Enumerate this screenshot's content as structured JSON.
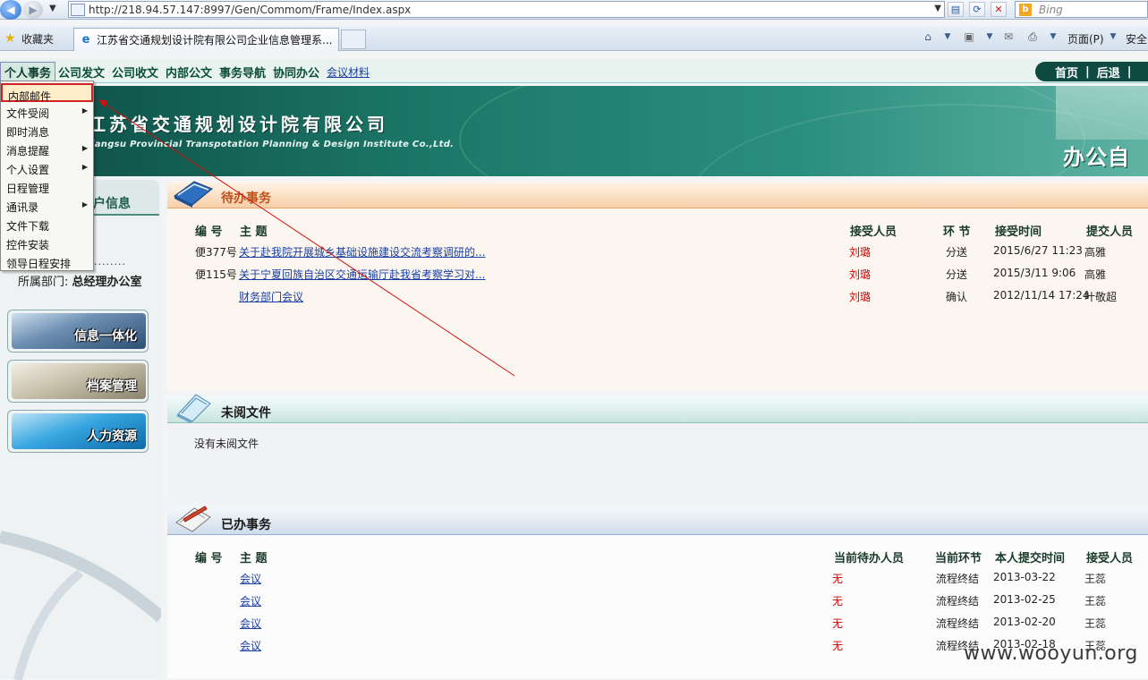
{
  "browser": {
    "url": "http://218.94.57.147:8997/Gen/Commom/Frame/Index.aspx",
    "search_placeholder": "Bing",
    "favorites_label": "收藏夹",
    "tab_title": "江苏省交通规划设计院有限公司企业信息管理系...",
    "page_menu": "页面(P)",
    "safety_menu": "安全"
  },
  "app_menu": {
    "items": [
      "个人事务",
      "公司发文",
      "公司收文",
      "内部公文",
      "事务导航",
      "协同办公"
    ],
    "link": "会议材料",
    "topnav": [
      "首页",
      "后退"
    ]
  },
  "banner": {
    "company_cn": "江苏省交通规划设计院有限公司",
    "company_en": "Jiangsu Provincial Transpotation Planning & Design Institute Co.,Ltd.",
    "system": "办公自动"
  },
  "dropdown": {
    "items": [
      {
        "label": "内部邮件",
        "arrow": ""
      },
      {
        "label": "文件受阅",
        "arrow": "▶"
      },
      {
        "label": "即时消息",
        "arrow": ""
      },
      {
        "label": "消息提醒",
        "arrow": "▶"
      },
      {
        "label": "个人设置",
        "arrow": "▶"
      },
      {
        "label": "日程管理",
        "arrow": ""
      },
      {
        "label": "通讯录",
        "arrow": "▶"
      },
      {
        "label": "文件下载",
        "arrow": ""
      },
      {
        "label": "控件安装",
        "arrow": ""
      },
      {
        "label": "领导日程安排",
        "arrow": ""
      }
    ]
  },
  "sidebar": {
    "userinfo_title": "户信息",
    "dots": "........",
    "dept_label": "所属部门:",
    "dept_value": "总经理办公室",
    "buttons": [
      "信息一体化",
      "档案管理",
      "人力资源"
    ]
  },
  "todo": {
    "title": "待办事务",
    "headers": {
      "id": "编 号",
      "subject": "主 题",
      "receiver": "接受人员",
      "step": "环 节",
      "time": "接受时间",
      "submitter": "提交人员"
    },
    "rows": [
      {
        "id": "便377号",
        "subject": "关于赴我院开展城乡基础设施建设交流考察调研的...",
        "receiver": "刘璐",
        "step": "分送",
        "time": "2015/6/27 11:23",
        "submitter": "高雅"
      },
      {
        "id": "便115号",
        "subject": "关于宁夏回族自治区交通运输厅赴我省考察学习对...",
        "receiver": "刘璐",
        "step": "分送",
        "time": "2015/3/11 9:06",
        "submitter": "高雅"
      },
      {
        "id": "",
        "subject": "财务部门会议",
        "receiver": "刘璐",
        "step": "确认",
        "time": "2012/11/14 17:24",
        "submitter": "叶敬超"
      }
    ]
  },
  "unread": {
    "title": "未阅文件",
    "empty_text": "没有未阅文件"
  },
  "done": {
    "title": "已办事务",
    "headers": {
      "id": "编 号",
      "subject": "主 题",
      "pending": "当前待办人员",
      "step": "当前环节",
      "time": "本人提交时间",
      "receiver": "接受人员"
    },
    "rows": [
      {
        "subject": "会议",
        "pending": "无",
        "step": "流程终结",
        "time": "2013-03-22",
        "receiver": "王蕊"
      },
      {
        "subject": "会议",
        "pending": "无",
        "step": "流程终结",
        "time": "2013-02-25",
        "receiver": "王蕊"
      },
      {
        "subject": "会议",
        "pending": "无",
        "step": "流程终结",
        "time": "2013-02-20",
        "receiver": "王蕊"
      },
      {
        "subject": "会议",
        "pending": "无",
        "step": "流程终结",
        "time": "2013-02-18",
        "receiver": "王蕊"
      }
    ]
  },
  "watermark": "www.wooyun.org"
}
